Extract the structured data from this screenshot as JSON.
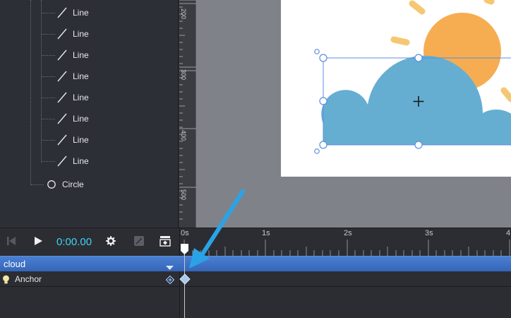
{
  "layers": {
    "items": [
      {
        "label": "Line",
        "icon": "line-icon"
      },
      {
        "label": "Line",
        "icon": "line-icon"
      },
      {
        "label": "Line",
        "icon": "line-icon"
      },
      {
        "label": "Line",
        "icon": "line-icon"
      },
      {
        "label": "Line",
        "icon": "line-icon"
      },
      {
        "label": "Line",
        "icon": "line-icon"
      },
      {
        "label": "Line",
        "icon": "line-icon"
      },
      {
        "label": "Line",
        "icon": "line-icon"
      },
      {
        "label": "Circle",
        "icon": "circle-icon"
      }
    ]
  },
  "ruler": {
    "labels": [
      "200",
      "300",
      "400",
      "500"
    ]
  },
  "timeline": {
    "time": "0:00.00",
    "ticks": [
      "0s",
      "1s",
      "2s",
      "3s",
      "4"
    ],
    "tracks": {
      "group_label": "cloud",
      "property_label": "Anchor"
    }
  },
  "colors": {
    "accent": "#3fd4f0",
    "track_group": "#3f74c8",
    "cloud": "#65aed2",
    "sun": "#f6ad52",
    "selection": "#5b8de0",
    "annotation_arrow": "#2aa3e6"
  }
}
